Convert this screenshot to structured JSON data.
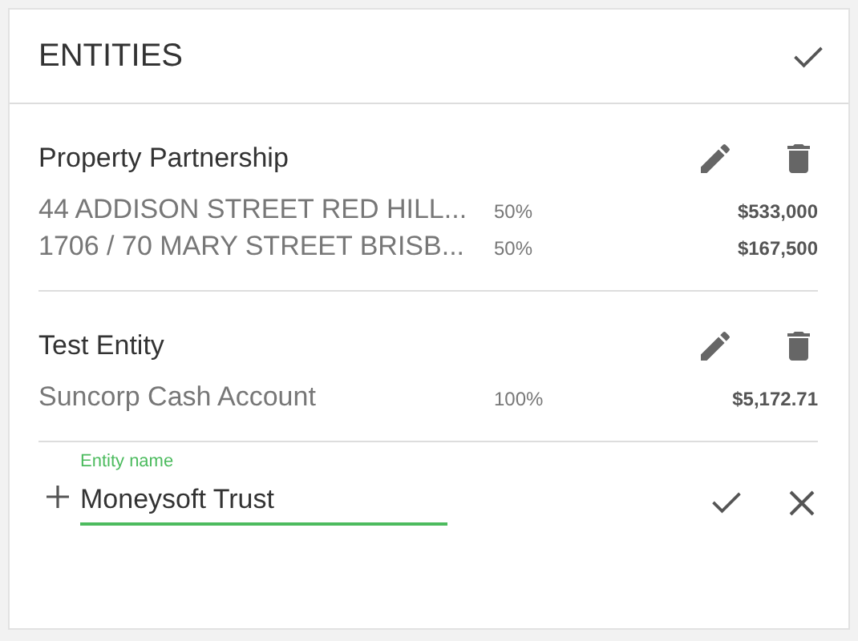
{
  "panel": {
    "title": "ENTITIES"
  },
  "entities": [
    {
      "name": "Property Partnership",
      "holdings": [
        {
          "description": "44 ADDISON STREET RED HILL...",
          "share": "50%",
          "amount": "$533,000"
        },
        {
          "description": "1706 / 70 MARY STREET BRISB...",
          "share": "50%",
          "amount": "$167,500"
        }
      ]
    },
    {
      "name": "Test Entity",
      "holdings": [
        {
          "description": "Suncorp Cash Account",
          "share": "100%",
          "amount": "$5,172.71"
        }
      ]
    }
  ],
  "new_entity": {
    "label": "Entity name",
    "value": "Moneysoft Trust",
    "focused": true
  }
}
